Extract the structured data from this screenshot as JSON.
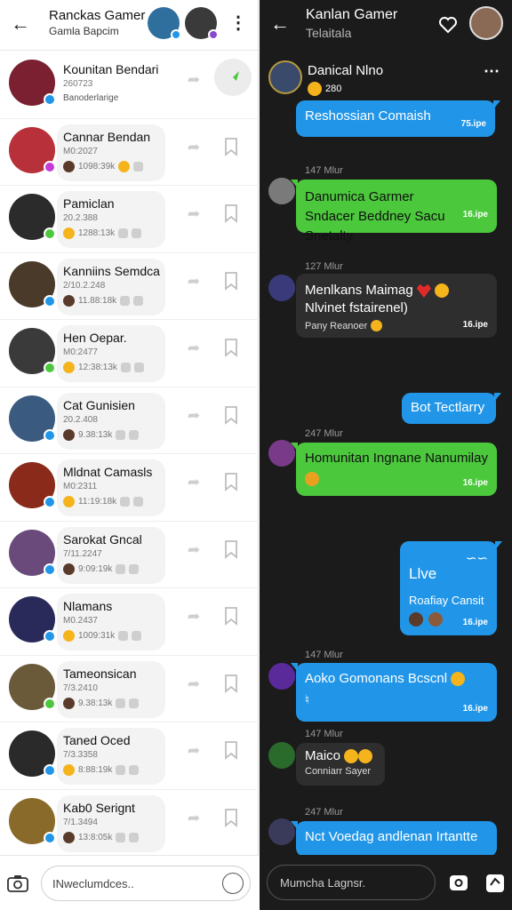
{
  "left": {
    "header": {
      "title": "Ranckas Gamer",
      "subtitle": "Gamla Bapcim"
    },
    "conversations": [
      {
        "name": "Kounitan Bendari",
        "id": "260723",
        "sub": "Banoderlarige",
        "color": "#7a2030"
      },
      {
        "name": "Cannar Bendan",
        "id": "M0:2027",
        "meta": "1098:39k",
        "color": "#b8313a"
      },
      {
        "name": "Pamiclan",
        "id": "20.2.388",
        "meta": "1288:13k",
        "color": "#2b2b2b"
      },
      {
        "name": "Kanniins Semdca",
        "id": "2/10.2.248",
        "meta": "11.88:18k",
        "color": "#4a3a2a"
      },
      {
        "name": "Hen Oepar.",
        "id": "M0:2477",
        "meta": "12:38:13k",
        "color": "#3a3a3a"
      },
      {
        "name": "Cat Gunisien",
        "id": "20.2.408",
        "meta": "9.38:13k",
        "color": "#3a5a80"
      },
      {
        "name": "Mldnat Camasls",
        "id": "M0:2311",
        "meta": "11:19:18k",
        "color": "#8a2a1a"
      },
      {
        "name": "Sarokat Gncal",
        "id": "7/11.2247",
        "meta": "9:09:19k",
        "color": "#6a4a7a"
      },
      {
        "name": "Nlamans",
        "id": "M0.2437",
        "meta": "1009:31k",
        "color": "#2a2a5a"
      },
      {
        "name": "Tameonsican",
        "id": "7/3.2410",
        "meta": "9.38:13k",
        "color": "#6a5a3a"
      },
      {
        "name": "Taned Oced",
        "id": "7/3.3358",
        "meta": "8:88:19k",
        "color": "#2a2a2a"
      },
      {
        "name": "Kab0 Serignt",
        "id": "7/1.3494",
        "meta": "13:8:05k",
        "color": "#8a6a2a"
      }
    ],
    "input_placeholder": "INweclumdces.."
  },
  "right": {
    "header": {
      "title": "Kanlan Gamer",
      "subtitle": "Telaitala"
    },
    "chat": {
      "top_sender": "Danical Nlno",
      "top_count": "280",
      "messages": [
        {
          "text": "Reshossian Comaish",
          "time": "75.ipe"
        },
        {
          "stamp": "147 Mlur",
          "text": "Danumica Garmer Sndacer Beddney Sacu Snetalty",
          "time": "16.ipe"
        },
        {
          "stamp": "127 Mlur",
          "text": "Menlkans Maimag",
          "text2": "Nlvinet fstairenel)",
          "sub": "Pany Reanoer",
          "time": "16.ipe"
        },
        {
          "text": "Bot Tectlarry"
        },
        {
          "stamp": "247 Mlur",
          "text": "Homunitan Ingnane Nanumilay",
          "time": "16.ipe"
        },
        {
          "title": "Llve",
          "sub": "Roafiay Cansit",
          "time": "16.ipe"
        },
        {
          "stamp": "147 Mlur",
          "text": "Aoko Gomonans Bcscnl",
          "time": "16.ipe"
        },
        {
          "stamp": "147 Mlur",
          "text": "Maico",
          "sub": "Conniarr Sayer"
        },
        {
          "stamp": "247 Mlur",
          "text": "Nct Voedag andlenan Irtantte"
        }
      ]
    },
    "input_placeholder": "Mumcha Lagnsr."
  }
}
